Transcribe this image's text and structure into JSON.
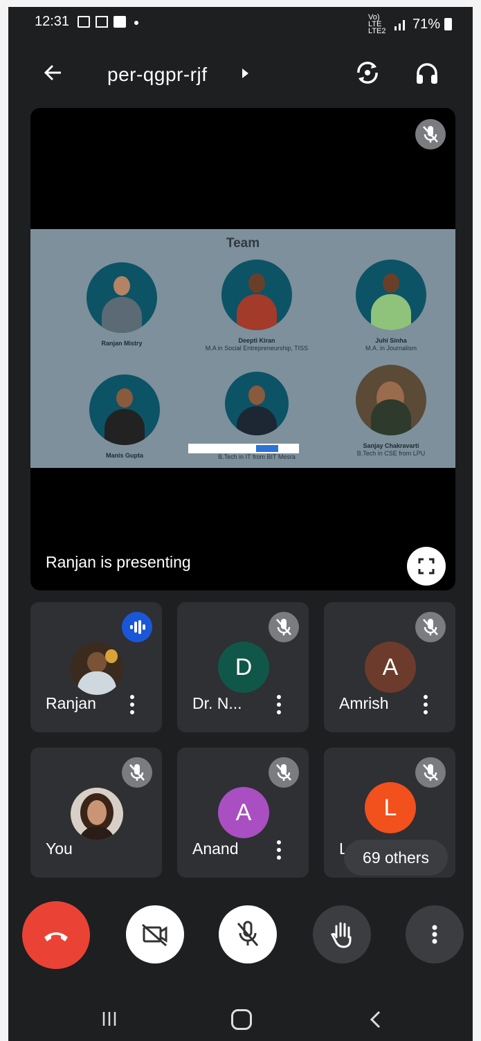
{
  "status_bar": {
    "time": "12:31",
    "network": "Vo) LTE LTE2",
    "battery": "71%"
  },
  "app_bar": {
    "meeting_code": "per-qgpr-rjf"
  },
  "presentation": {
    "presenting_text": "Ranjan is presenting",
    "slide": {
      "title": "Team",
      "members": [
        {
          "name": "Ranjan Mistry",
          "role": ""
        },
        {
          "name": "Deepti Kiran",
          "role": "M.A in Social Entrepreneurship, TISS"
        },
        {
          "name": "Juhi Sinha",
          "role": "M.A. in Journalism"
        },
        {
          "name": "Manis Gupta",
          "role": ""
        },
        {
          "name": "",
          "role": "B.Tech in IT from BIT Mesra"
        },
        {
          "name": "Sanjay Chakravarti",
          "role": "B.Tech in CSE from LPU"
        }
      ]
    }
  },
  "participants": [
    {
      "name": "Ranjan",
      "initial": "",
      "color": "",
      "speaking": true
    },
    {
      "name": "Dr. N...",
      "initial": "D",
      "color": "#10574a",
      "speaking": false
    },
    {
      "name": "Amrish",
      "initial": "A",
      "color": "#6d3b2c",
      "speaking": false
    },
    {
      "name": "You",
      "initial": "",
      "color": "",
      "speaking": false
    },
    {
      "name": "Anand",
      "initial": "A",
      "color": "#a94fc2",
      "speaking": false
    },
    {
      "name": "L",
      "initial": "L",
      "color": "#f2501d",
      "speaking": false
    }
  ],
  "others_label": "69 others",
  "colors": {
    "end_call": "#ea4335",
    "speaking_badge": "#1a57d8",
    "background": "#1e1f21"
  },
  "controls": [
    "end-call",
    "camera-off",
    "mic-off",
    "raise-hand",
    "more-options"
  ]
}
